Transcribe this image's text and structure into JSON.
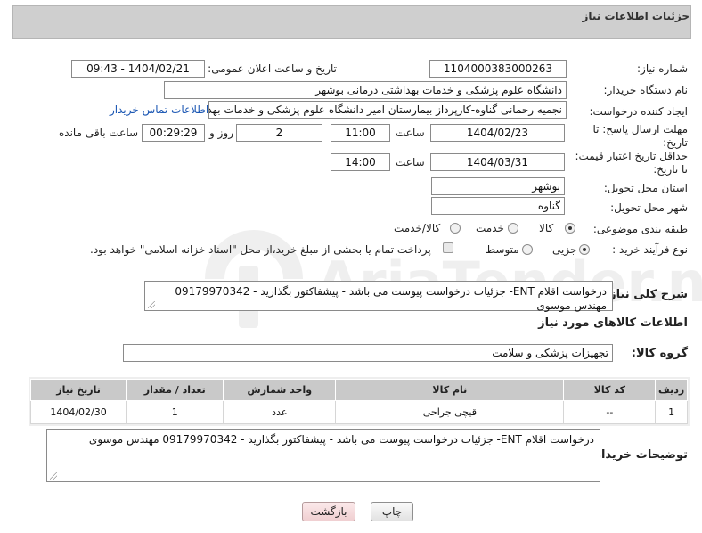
{
  "header": {
    "title": "جزئیات اطلاعات نیاز"
  },
  "fields": {
    "need_number_label": "شماره نیاز:",
    "need_number": "1104000383000263",
    "announce_label": "تاریخ و ساعت اعلان عمومی:",
    "announce_value": "1404/02/21 - 09:43",
    "buyer_org_label": "نام دستگاه خریدار:",
    "buyer_org": "دانشگاه علوم پزشکی و خدمات بهداشتی درمانی بوشهر",
    "requester_label": "ایجاد کننده درخواست:",
    "requester": "نجمیه رحمانی گناوه-کارپرداز بیمارستان امیر دانشگاه علوم پزشکی و خدمات بهد",
    "contact_link": "اطلاعات تماس خریدار",
    "deadline_label_1": "مهلت ارسال پاسخ: تا",
    "deadline_label_2": "تاریخ:",
    "deadline_date": "1404/02/23",
    "time_label": "ساعت",
    "deadline_time": "11:00",
    "days_value": "2",
    "days_label": "روز و",
    "remaining_time": "00:29:29",
    "remaining_label": "ساعت باقی مانده",
    "validity_label_1": "حداقل تاریخ اعتبار قیمت:",
    "validity_label_2": "تا تاریخ:",
    "validity_date": "1404/03/31",
    "validity_time": "14:00",
    "province_label": "استان محل تحویل:",
    "province": "بوشهر",
    "city_label": "شهر محل تحویل:",
    "city": "گناوه",
    "category_label": "طبقه بندی موضوعی:",
    "category_options": [
      "کالا",
      "خدمت",
      "کالا/خدمت"
    ],
    "category_selected": "کالا",
    "process_label": "نوع فرآیند خرید :",
    "process_options": [
      "جزیی",
      "متوسط"
    ],
    "process_selected": "جزیی",
    "payment_note": "پرداخت تمام یا بخشی از مبلغ خرید،از محل \"اسناد خزانه اسلامی\" خواهد بود.",
    "summary_label": "شرح کلی نیاز:",
    "summary": "درخواست اقلام ENT- جزئیات درخواست پیوست می باشد - پیشفاکتور بگذارید - 09179970342 مهندس موسوی",
    "goods_info_title": "اطلاعات کالاهای مورد نیاز",
    "goods_group_label": "گروه کالا:",
    "goods_group": "تجهیزات پزشکی و سلامت",
    "buyer_notes_label": "توضیحات خریدار:",
    "buyer_notes": "درخواست اقلام ENT- جزئیات درخواست پیوست می باشد - پیشفاکتور بگذارید - 09179970342 مهندس موسوی"
  },
  "table": {
    "headers": [
      "ردیف",
      "کد کالا",
      "نام کالا",
      "واحد شمارش",
      "تعداد / مقدار",
      "تاریخ نیاز"
    ],
    "rows": [
      [
        "1",
        "--",
        "قیچی جراحی",
        "عدد",
        "1",
        "1404/02/30"
      ]
    ]
  },
  "buttons": {
    "print": "چاپ",
    "back": "بازگشت"
  },
  "watermark": {
    "text": "AriaTender.neT"
  }
}
